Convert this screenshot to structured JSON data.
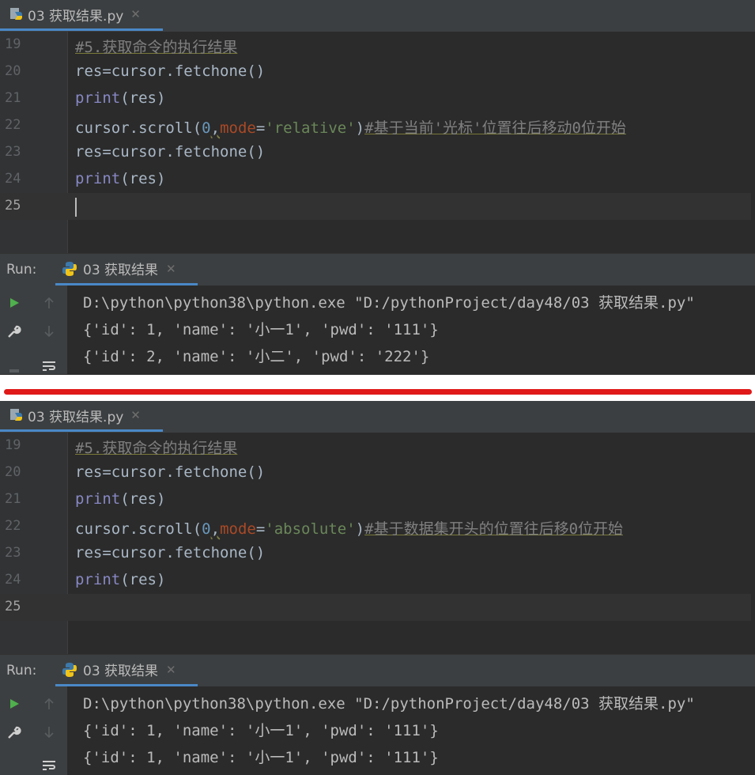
{
  "panels": [
    {
      "file_tab": {
        "label": "03 获取结果.py",
        "icon": "python-file-icon"
      },
      "lines": [
        {
          "num": "19",
          "code": "#5.获取命令的执行结果"
        },
        {
          "num": "20",
          "code": "res=cursor.fetchone()"
        },
        {
          "num": "21",
          "code": "print(res)"
        },
        {
          "num": "22",
          "code": "cursor.scroll(0,mode='relative')#基于当前'光标'位置往后移动0位开始"
        },
        {
          "num": "23",
          "code": "res=cursor.fetchone()"
        },
        {
          "num": "24",
          "code": "print(res)"
        },
        {
          "num": "25",
          "code": ""
        }
      ],
      "run": {
        "label": "Run:",
        "tab_label": "03 获取结果",
        "output": [
          "D:\\python\\python38\\python.exe \"D:/pythonProject/day48/03 获取结果.py\"",
          "{'id': 1, 'name': '小一1', 'pwd': '111'}",
          "{'id': 2, 'name': '小二', 'pwd': '222'}"
        ]
      }
    },
    {
      "file_tab": {
        "label": "03 获取结果.py",
        "icon": "python-file-icon"
      },
      "lines": [
        {
          "num": "19",
          "code": "#5.获取命令的执行结果"
        },
        {
          "num": "20",
          "code": "res=cursor.fetchone()"
        },
        {
          "num": "21",
          "code": "print(res)"
        },
        {
          "num": "22",
          "code": "cursor.scroll(0,mode='absolute')#基于数据集开头的位置往后移0位开始"
        },
        {
          "num": "23",
          "code": "res=cursor.fetchone()"
        },
        {
          "num": "24",
          "code": "print(res)"
        },
        {
          "num": "25",
          "code": ""
        }
      ],
      "run": {
        "label": "Run:",
        "tab_label": "03 获取结果",
        "output": [
          "D:\\python\\python38\\python.exe \"D:/pythonProject/day48/03 获取结果.py\"",
          "{'id': 1, 'name': '小一1', 'pwd': '111'}",
          "{'id': 1, 'name': '小一1', 'pwd': '111'}"
        ]
      }
    }
  ],
  "colors": {
    "accent": "#4a88c7",
    "divider": "#e01919",
    "editor_bg": "#2b2b2b",
    "comment": "#808080",
    "string": "#6a8759",
    "keyword_arg": "#aa4926",
    "builtin": "#8888c6"
  }
}
